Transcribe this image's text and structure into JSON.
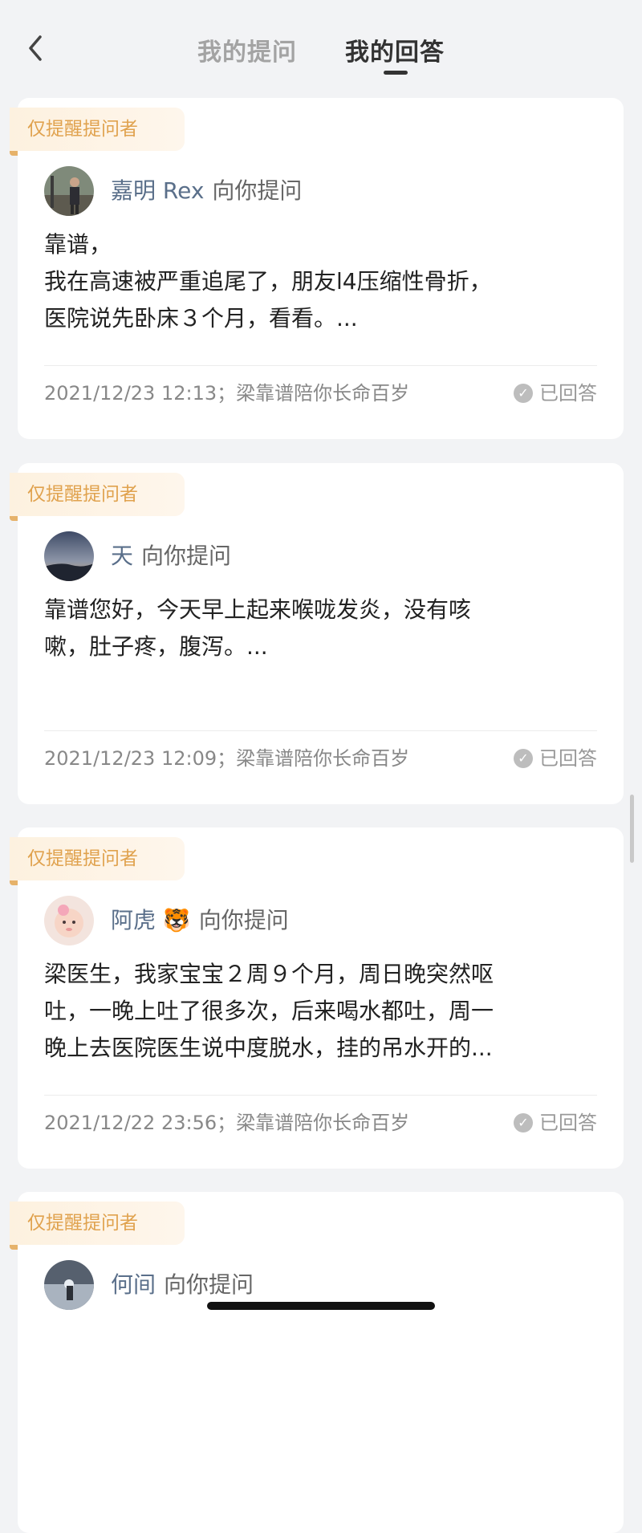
{
  "header": {
    "tabs": [
      {
        "label": "我的提问",
        "active": false
      },
      {
        "label": "我的回答",
        "active": true
      }
    ]
  },
  "cards": [
    {
      "badge": "仅提醒提问者",
      "asker": "嘉明 Rex",
      "asker_suffix": "向你提问",
      "text": "靠谱，\n我在高速被严重追尾了，朋友l4压缩性骨折，\n医院说先卧床３个月，看看。...",
      "meta": "2021/12/23 12:13；梁靠谱陪你长命百岁",
      "status": "已回答"
    },
    {
      "badge": "仅提醒提问者",
      "asker": "天",
      "asker_suffix": "向你提问",
      "text": "靠谱您好，今天早上起来喉咙发炎，没有咳\n嗽，肚子疼，腹泻。...",
      "meta": "2021/12/23 12:09；梁靠谱陪你长命百岁",
      "status": "已回答"
    },
    {
      "badge": "仅提醒提问者",
      "asker": "阿虎 🐯",
      "asker_suffix": "向你提问",
      "text": "梁医生，我家宝宝２周９个月，周日晚突然呕\n吐，一晚上吐了很多次，后来喝水都吐，周一\n晚上去医院医生说中度脱水，挂的吊水开的...",
      "meta": "2021/12/22 23:56；梁靠谱陪你长命百岁",
      "status": "已回答"
    },
    {
      "badge": "仅提醒提问者",
      "asker": "何间",
      "asker_suffix": "向你提问",
      "text": "",
      "meta": "",
      "status": ""
    }
  ],
  "colors": {
    "badge_text": "#e0a24e",
    "asker_name": "#5a6f8a",
    "active_tab": "#333333",
    "inactive_tab": "#a3a3a3"
  },
  "icons": [
    "chevron-left-icon",
    "check-circle-icon"
  ]
}
